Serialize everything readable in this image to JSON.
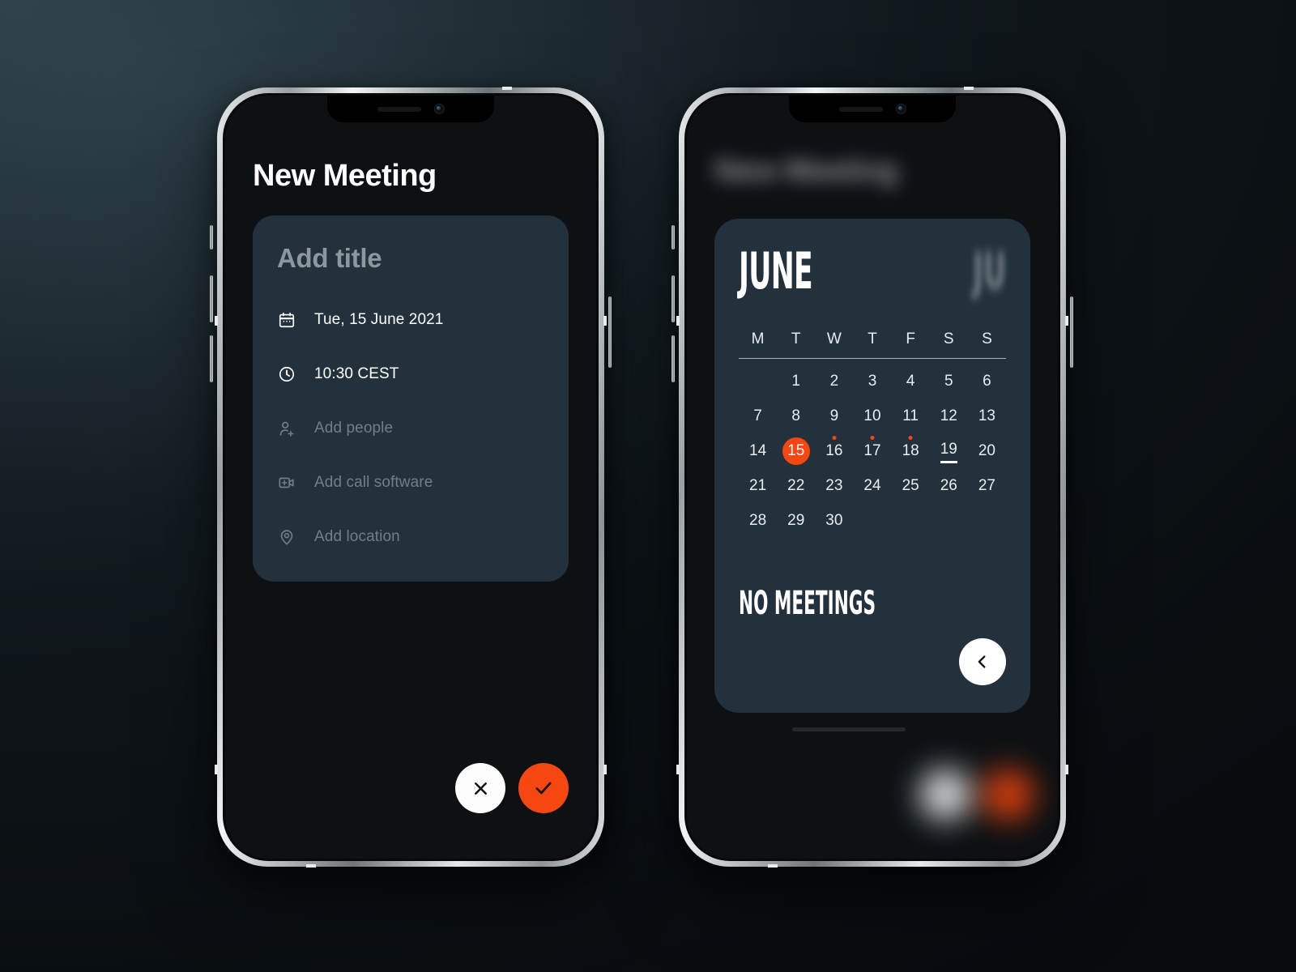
{
  "theme": {
    "accent": "#F5470F",
    "card_bg": "#22313B",
    "screen_bg": "#0D1114",
    "text_primary": "#FFFFFF",
    "text_muted": "#737F86"
  },
  "left_phone": {
    "page_title": "New Meeting",
    "card": {
      "title_placeholder": "Add title",
      "rows": [
        {
          "icon": "calendar-icon",
          "text": "Tue, 15 June 2021",
          "state": "filled"
        },
        {
          "icon": "clock-icon",
          "text": "10:30 CEST",
          "state": "filled"
        },
        {
          "icon": "add-person-icon",
          "text": "Add people",
          "state": "empty"
        },
        {
          "icon": "video-call-icon",
          "text": "Add call software",
          "state": "empty"
        },
        {
          "icon": "location-pin-icon",
          "text": "Add location",
          "state": "empty"
        }
      ]
    },
    "actions": {
      "cancel_label": "✕",
      "confirm_label": "✓"
    }
  },
  "right_phone": {
    "blurred_header": "New Meeting",
    "calendar": {
      "month": "JUNE",
      "next_month": "JU",
      "weekdays": [
        "M",
        "T",
        "W",
        "T",
        "F",
        "S",
        "S"
      ],
      "leading_blanks": 1,
      "days": [
        {
          "n": "1"
        },
        {
          "n": "2"
        },
        {
          "n": "3"
        },
        {
          "n": "4"
        },
        {
          "n": "5"
        },
        {
          "n": "6"
        },
        {
          "n": "7"
        },
        {
          "n": "8"
        },
        {
          "n": "9"
        },
        {
          "n": "10"
        },
        {
          "n": "11"
        },
        {
          "n": "12"
        },
        {
          "n": "13"
        },
        {
          "n": "14"
        },
        {
          "n": "15",
          "selected": true
        },
        {
          "n": "16",
          "dot": true
        },
        {
          "n": "17",
          "dot": true
        },
        {
          "n": "18",
          "dot": true
        },
        {
          "n": "19",
          "today": true
        },
        {
          "n": "20"
        },
        {
          "n": "21"
        },
        {
          "n": "22"
        },
        {
          "n": "23"
        },
        {
          "n": "24"
        },
        {
          "n": "25"
        },
        {
          "n": "26"
        },
        {
          "n": "27"
        },
        {
          "n": "28"
        },
        {
          "n": "29"
        },
        {
          "n": "30"
        }
      ],
      "status": "NO MEETINGS",
      "back_label": "‹"
    }
  }
}
